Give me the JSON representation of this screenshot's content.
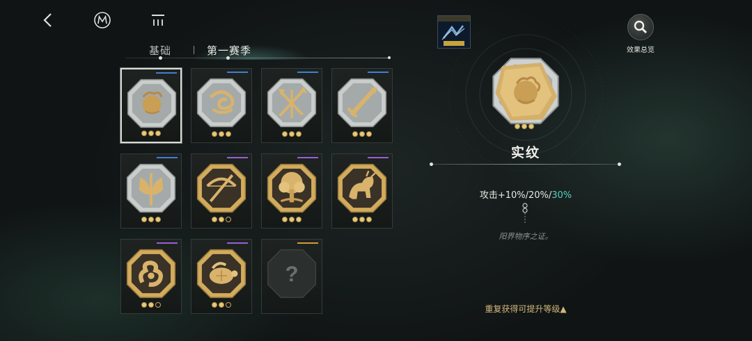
{
  "header": {
    "back_icon": "back-arrow-icon",
    "logo_icon": "m-circle-logo-icon",
    "menu_icon": "list-menu-icon"
  },
  "tabs": [
    {
      "label": "基础",
      "active": false
    },
    {
      "label": "第一赛季",
      "active": true
    }
  ],
  "badge": {
    "icon": "rank-badge-icon"
  },
  "summary": {
    "label": "效果总览",
    "icon": "magnifier-icon"
  },
  "cards": [
    {
      "emblem": "flame-lion-emblem-icon",
      "rank_color": "#3f7fd6",
      "pips": [
        1,
        1,
        1
      ],
      "selected": true
    },
    {
      "emblem": "coiled-serpent-emblem-icon",
      "rank_color": "#3f7fd6",
      "pips": [
        1,
        1,
        1
      ],
      "selected": false
    },
    {
      "emblem": "crossed-arrows-emblem-icon",
      "rank_color": "#3f7fd6",
      "pips": [
        1,
        1,
        1
      ],
      "selected": false
    },
    {
      "emblem": "sword-emblem-icon",
      "rank_color": "#3f7fd6",
      "pips": [
        1,
        1,
        1
      ],
      "selected": false
    },
    {
      "emblem": "axe-emblem-icon",
      "rank_color": "#3f7fd6",
      "pips": [
        1,
        1,
        1
      ],
      "selected": false
    },
    {
      "emblem": "crossbow-emblem-icon",
      "rank_color": "#9a5fd6",
      "pips": [
        1,
        1,
        0
      ],
      "selected": false
    },
    {
      "emblem": "tree-emblem-icon",
      "rank_color": "#9a5fd6",
      "pips": [
        1,
        1,
        1
      ],
      "selected": false
    },
    {
      "emblem": "qilin-emblem-icon",
      "rank_color": "#9a5fd6",
      "pips": [
        1,
        1,
        1
      ],
      "selected": false
    },
    {
      "emblem": "ruyi-cloud-emblem-icon",
      "rank_color": "#9a5fd6",
      "pips": [
        1,
        1,
        0
      ],
      "selected": false
    },
    {
      "emblem": "turtle-emblem-icon",
      "rank_color": "#9a5fd6",
      "pips": [
        1,
        1,
        0
      ],
      "selected": false
    },
    {
      "emblem": "unknown-question-icon",
      "rank_color": "#d49a3c",
      "pips": [],
      "selected": false
    }
  ],
  "detail": {
    "name": "实纹",
    "pips": [
      1,
      1,
      1
    ],
    "effect_prefix": "攻击+10%/20%/",
    "effect_highlight": "30%",
    "lore": "阳界物序之证。",
    "upgrade_hint": "重复获得可提升等级▲"
  },
  "colors": {
    "accent": "#57d0c2",
    "gold": "#e8c87a",
    "hint": "#d2b77b"
  }
}
